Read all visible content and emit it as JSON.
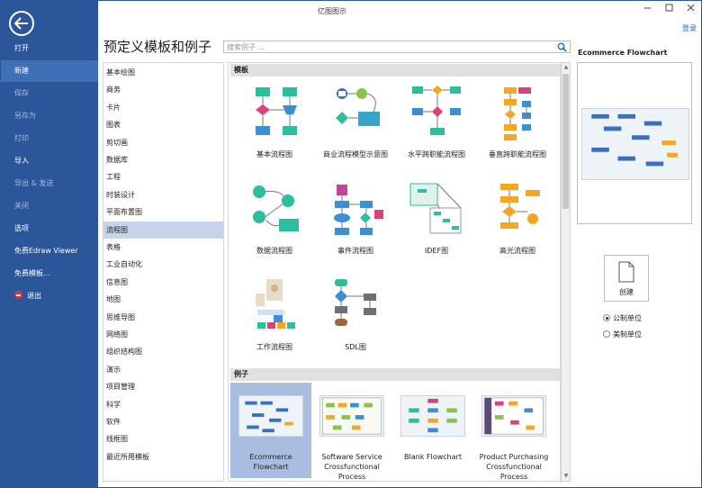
{
  "window": {
    "title": "亿图图示",
    "login": "登录"
  },
  "sidebar": {
    "items": [
      {
        "label": "打开",
        "state": "normal"
      },
      {
        "label": "新建",
        "state": "active"
      },
      {
        "label": "保存",
        "state": "dim"
      },
      {
        "label": "另存为",
        "state": "dim"
      },
      {
        "label": "打印",
        "state": "dim"
      },
      {
        "label": "导入",
        "state": "normal"
      },
      {
        "label": "导出 & 发送",
        "state": "dim"
      },
      {
        "label": "关闭",
        "state": "dim"
      },
      {
        "label": "选项",
        "state": "normal"
      },
      {
        "label": "免费Edraw Viewer",
        "state": "normal"
      },
      {
        "label": "免费模板...",
        "state": "normal"
      },
      {
        "label": "退出",
        "state": "normal"
      }
    ]
  },
  "main_heading": "预定义模板和例子",
  "search": {
    "placeholder": "搜索例子 ..."
  },
  "categories": [
    "基本绘图",
    "商务",
    "卡片",
    "图表",
    "剪切画",
    "数据库",
    "工程",
    "时装设计",
    "平面布置图",
    "流程图",
    "表格",
    "工业自动化",
    "信息图",
    "地图",
    "思维导图",
    "网络图",
    "组织结构图",
    "演示",
    "项目管理",
    "科学",
    "软件",
    "线框图",
    "最近所用模板"
  ],
  "selected_category": "流程图",
  "templates_section": "模板",
  "templates": [
    "基本流程图",
    "商业流程模型示意图",
    "水平跨职能流程图",
    "垂直跨职能流程图",
    "数据流程图",
    "事件流程图",
    "IDEF图",
    "高光流程图",
    "工作流程图",
    "SDL图"
  ],
  "examples_section": "例子",
  "examples": [
    {
      "line1": "Ecommerce",
      "line2": "Flowchart",
      "line3": ""
    },
    {
      "line1": "Software Service",
      "line2": "Crossfunctional",
      "line3": "Process"
    },
    {
      "line1": "Blank Flowchart",
      "line2": "",
      "line3": ""
    },
    {
      "line1": "Product Purchasing",
      "line2": "Crossfunctional",
      "line3": "Process"
    }
  ],
  "preview": {
    "title": "Ecommerce Flowchart"
  },
  "create_label": "创建",
  "units": [
    {
      "label": "公制单位",
      "checked": true
    },
    {
      "label": "美制单位",
      "checked": false
    }
  ],
  "colors": {
    "sidebar": "#2b579a",
    "accent_teal": "#2bbf9b",
    "accent_blue": "#3a8fd6",
    "accent_pink": "#e0407a",
    "accent_orange": "#f5a623"
  }
}
